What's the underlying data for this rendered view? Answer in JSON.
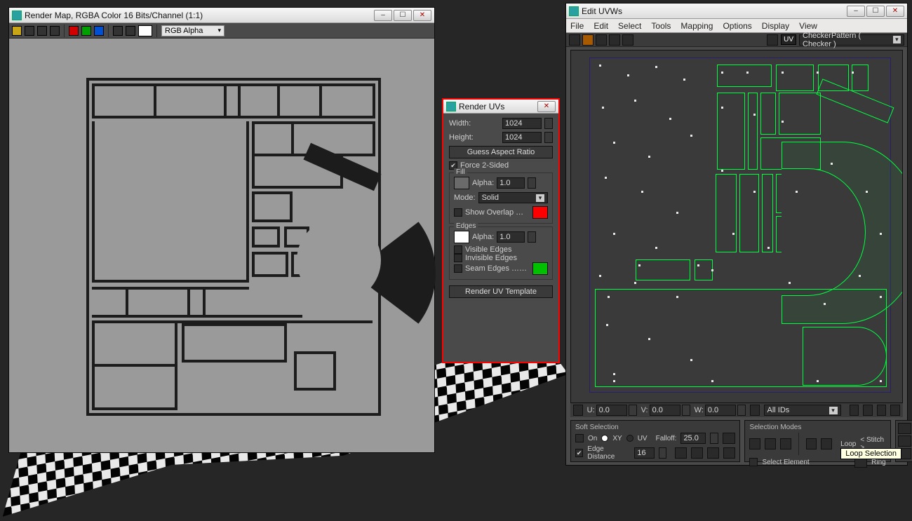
{
  "renderMap": {
    "title": "Render Map, RGBA Color 16 Bits/Channel (1:1)",
    "channel_dd": "RGB Alpha"
  },
  "renderUVs": {
    "title": "Render UVs",
    "width_label": "Width:",
    "width_value": "1024",
    "height_label": "Height:",
    "height_value": "1024",
    "guess_btn": "Guess Aspect Ratio",
    "force2sided": "Force 2-Sided",
    "fill": {
      "title": "Fill",
      "alpha_label": "Alpha:",
      "alpha_value": "1.0",
      "mode_label": "Mode:",
      "mode_value": "Solid",
      "overlap_label": "Show Overlap …"
    },
    "edges": {
      "title": "Edges",
      "alpha_label": "Alpha:",
      "alpha_value": "1.0",
      "visible": "Visible Edges",
      "invisible": "Invisible Edges",
      "seam": "Seam Edges ……"
    },
    "render_btn": "Render UV Template"
  },
  "editUVW": {
    "title": "Edit UVWs",
    "menus": [
      "File",
      "Edit",
      "Select",
      "Tools",
      "Mapping",
      "Options",
      "Display",
      "View"
    ],
    "uv_badge": "UV",
    "checker_dd": "CheckerPattern  ( Checker )",
    "status": {
      "u_label": "U:",
      "u_val": "0.0",
      "v_label": "V:",
      "v_val": "0.0",
      "w_label": "W:",
      "w_val": "0.0",
      "ids": "All IDs"
    },
    "soft": {
      "title": "Soft Selection",
      "on": "On",
      "xy": "XY",
      "uv": "UV",
      "falloff": "Falloff:",
      "falloff_val": "25.0",
      "edge_dist": "Edge Distance",
      "edge_dist_val": "16"
    },
    "selmodes": {
      "title": "Selection Modes",
      "select_elem": "Select Element",
      "loop": "Loop",
      "ring": "Ring",
      "stitch": "< Stitch >"
    },
    "tooltip": "Loop Selection"
  }
}
